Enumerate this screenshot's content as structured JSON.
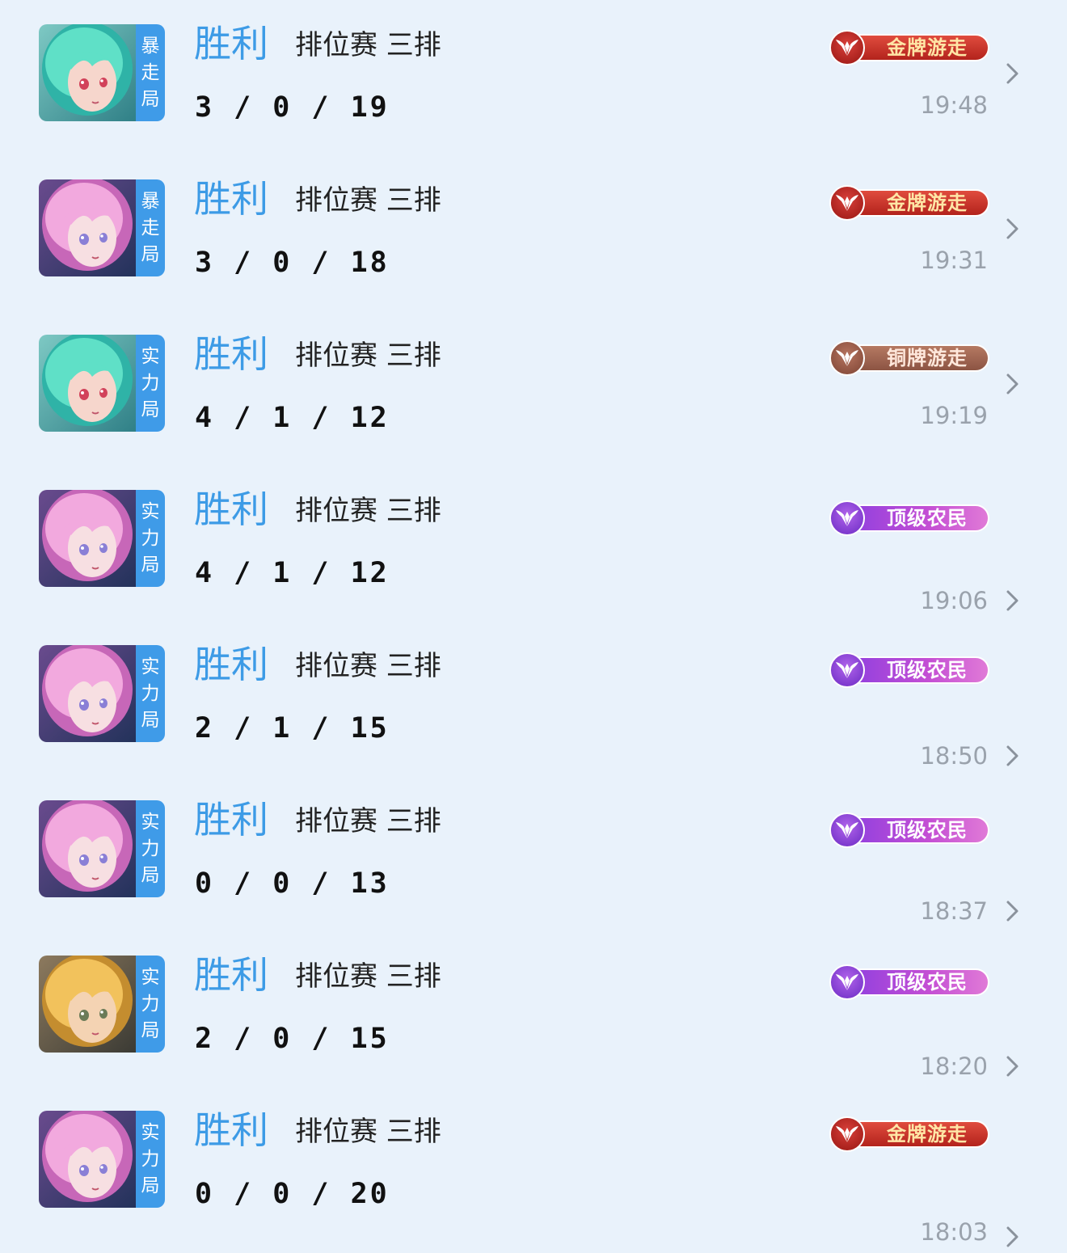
{
  "matches": [
    {
      "hero": "teal",
      "mode": "暴走局",
      "result": "胜利",
      "type": "排位赛 三排",
      "kda": "3 / 0 / 19",
      "badge": {
        "label": "金牌游走",
        "style": "gold"
      },
      "time": "19:48"
    },
    {
      "hero": "pink",
      "mode": "暴走局",
      "result": "胜利",
      "type": "排位赛 三排",
      "kda": "3 / 0 / 18",
      "badge": {
        "label": "金牌游走",
        "style": "gold"
      },
      "time": "19:31"
    },
    {
      "hero": "teal",
      "mode": "实力局",
      "result": "胜利",
      "type": "排位赛 三排",
      "kda": "4 / 1 / 12",
      "badge": {
        "label": "铜牌游走",
        "style": "bronze"
      },
      "time": "19:19"
    },
    {
      "hero": "pink",
      "mode": "实力局",
      "result": "胜利",
      "type": "排位赛 三排",
      "kda": "4 / 1 / 12",
      "badge": {
        "label": "顶级农民",
        "style": "purple"
      },
      "time": "19:06"
    },
    {
      "hero": "pink",
      "mode": "实力局",
      "result": "胜利",
      "type": "排位赛 三排",
      "kda": "2 / 1 / 15",
      "badge": {
        "label": "顶级农民",
        "style": "purple"
      },
      "time": "18:50"
    },
    {
      "hero": "pink",
      "mode": "实力局",
      "result": "胜利",
      "type": "排位赛 三排",
      "kda": "0 / 0 / 13",
      "badge": {
        "label": "顶级农民",
        "style": "purple"
      },
      "time": "18:37"
    },
    {
      "hero": "blonde",
      "mode": "实力局",
      "result": "胜利",
      "type": "排位赛 三排",
      "kda": "2 / 0 / 15",
      "badge": {
        "label": "顶级农民",
        "style": "purple"
      },
      "time": "18:20"
    },
    {
      "hero": "pink",
      "mode": "实力局",
      "result": "胜利",
      "type": "排位赛 三排",
      "kda": "0 / 0 / 20",
      "badge": {
        "label": "金牌游走",
        "style": "gold"
      },
      "time": "18:03"
    }
  ],
  "colors": {
    "background": "#e9f2fb",
    "result_blue": "#3d9be6",
    "mode_strip": "#3f9be8",
    "time_gray": "#9aa2ac",
    "chevron_gray": "#8a929c"
  },
  "icons": {
    "row_chevron": "chevron-right-icon",
    "badge_emblem": "wings-emblem-icon"
  }
}
